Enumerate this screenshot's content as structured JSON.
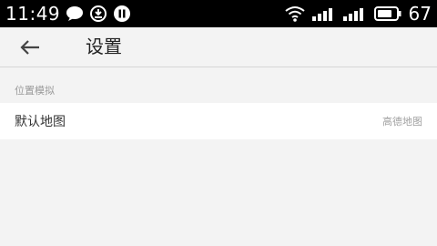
{
  "status_bar": {
    "time": "11:49",
    "battery_level": "67",
    "icons": [
      "chat-bubble-icon",
      "sync-icon",
      "pause-icon",
      "wifi-icon",
      "signal-icon",
      "signal-icon",
      "battery-icon"
    ]
  },
  "toolbar": {
    "title": "设置",
    "back_icon": "arrow-left-icon"
  },
  "section": {
    "header": "位置模拟",
    "items": [
      {
        "label": "默认地图",
        "value": "高德地图"
      }
    ]
  },
  "colors": {
    "status_bar_bg": "#000000",
    "page_bg": "#f3f3f3",
    "row_bg": "#ffffff",
    "secondary_text": "#9a9a9a"
  }
}
